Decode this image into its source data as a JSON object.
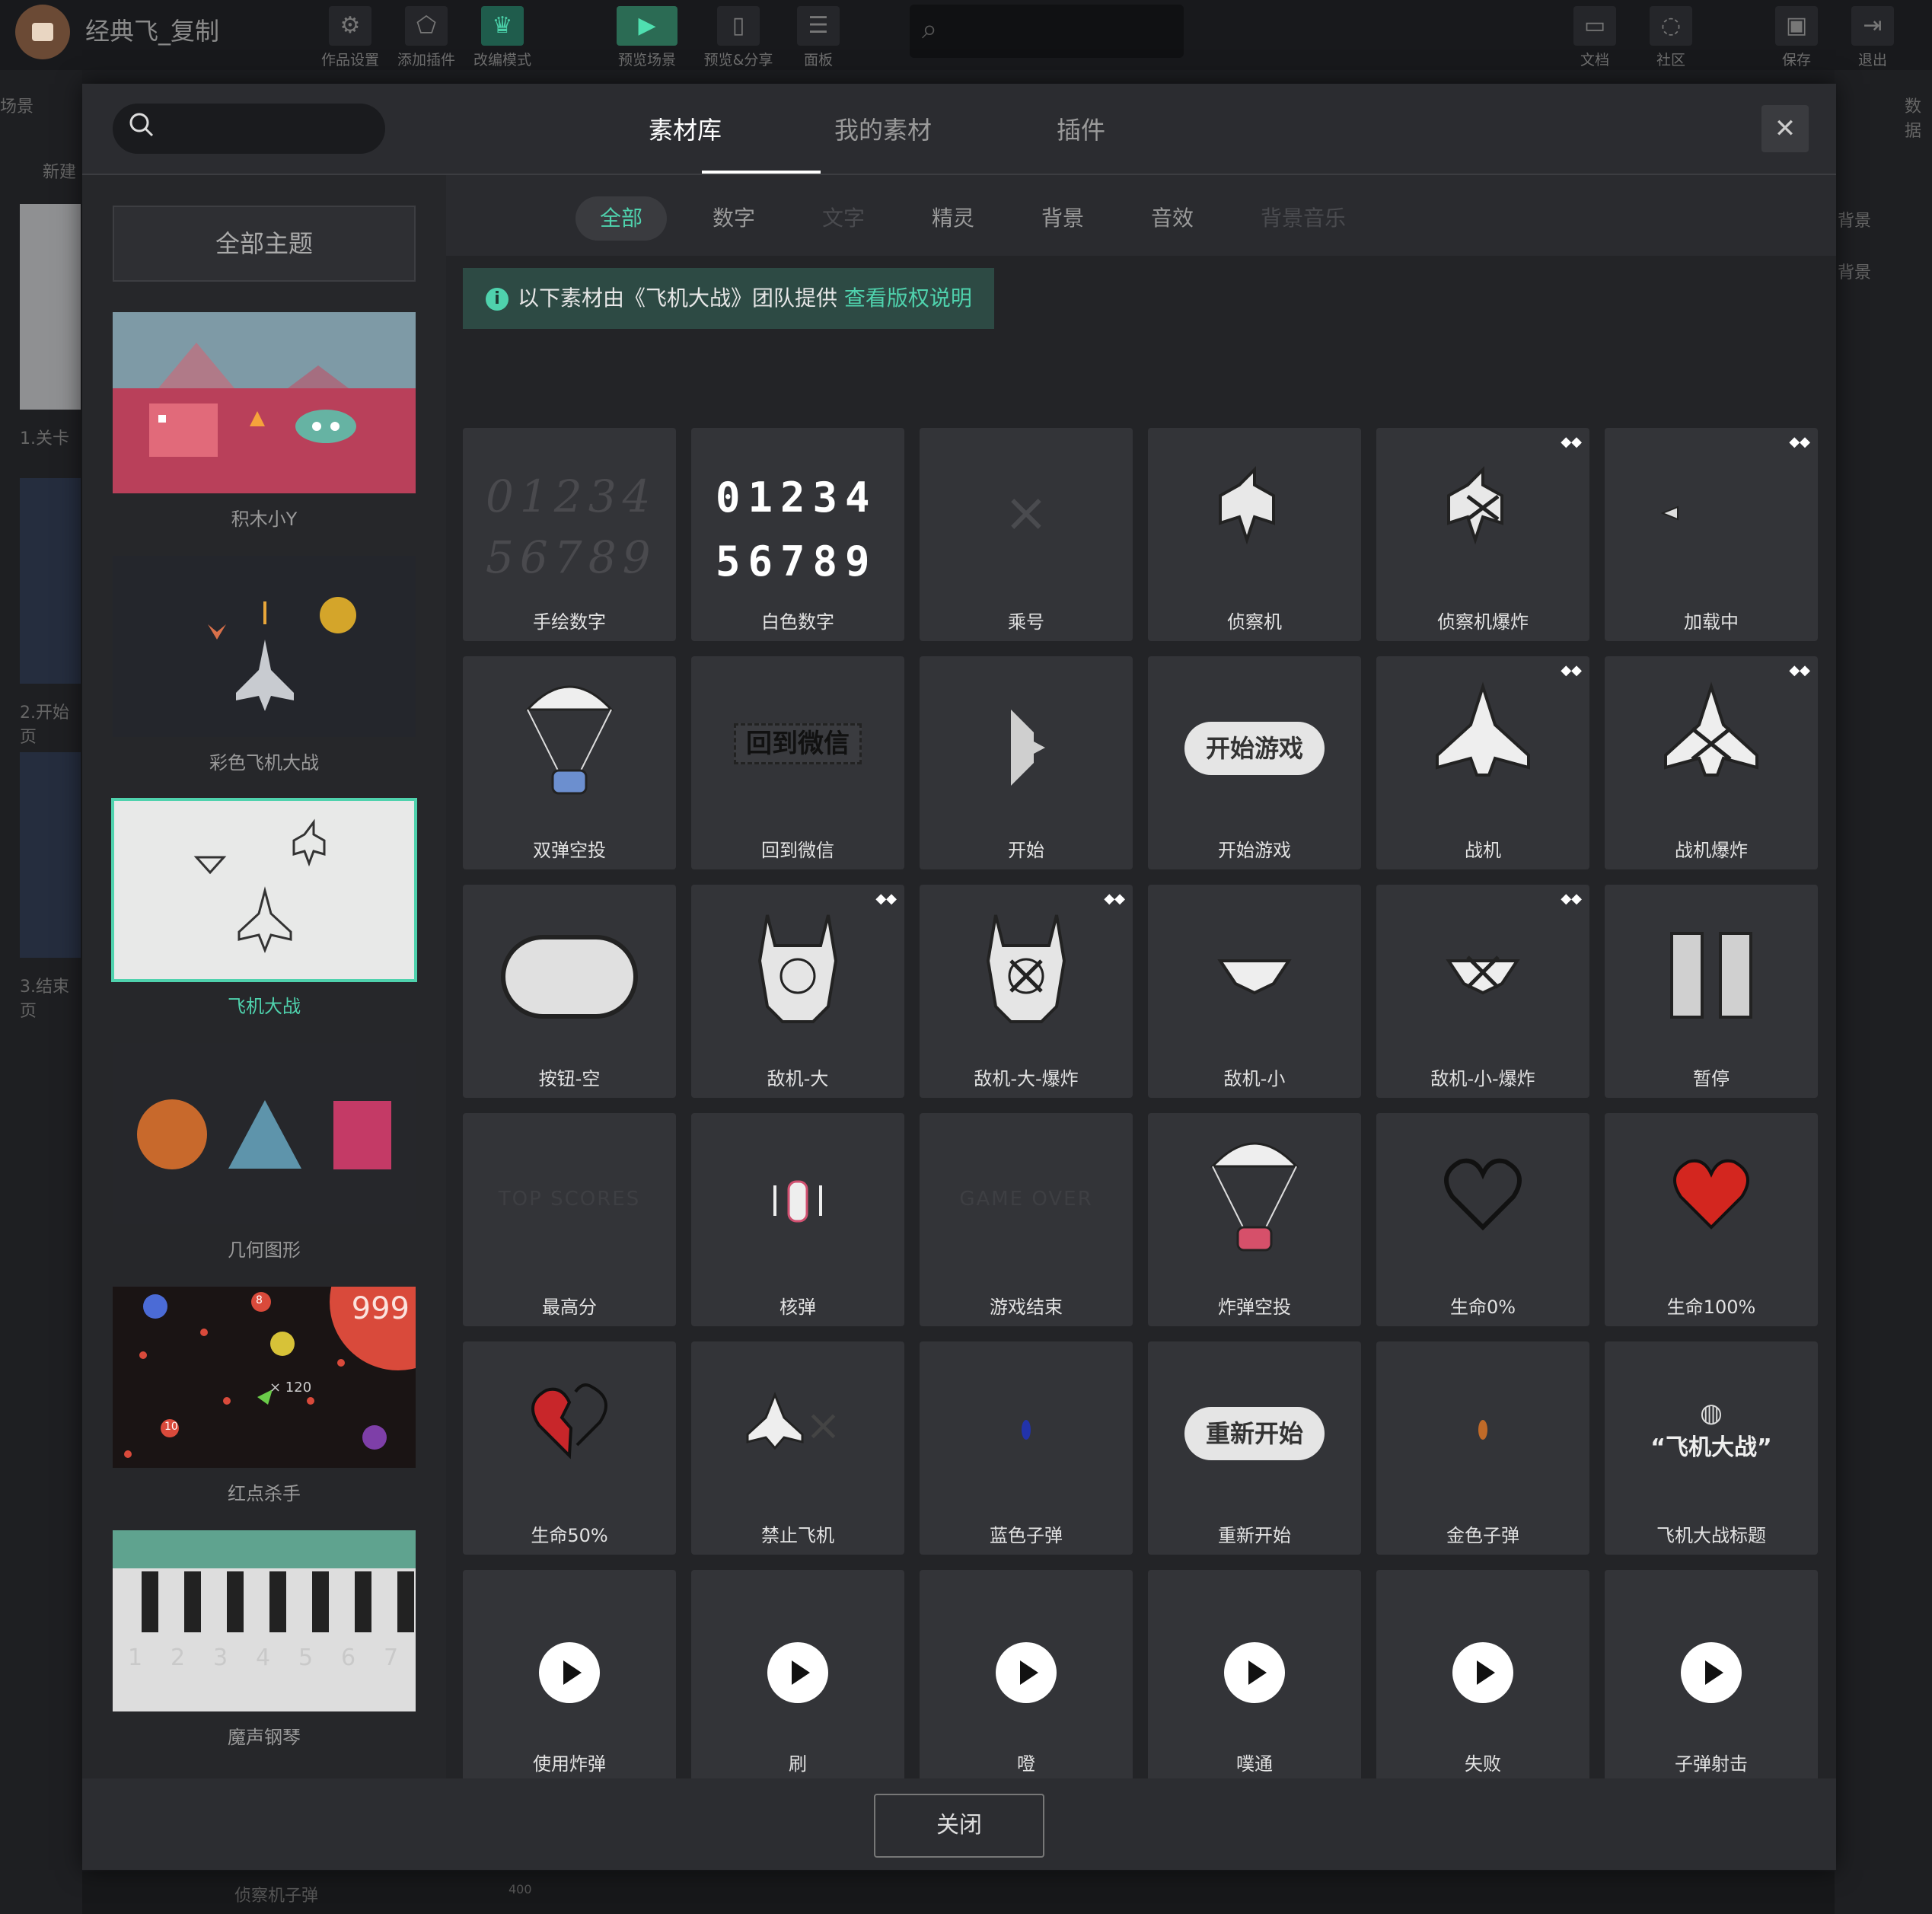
{
  "app": {
    "title": "经典飞_复制"
  },
  "toolbar": [
    {
      "label": "作品设置",
      "icon": "⚙"
    },
    {
      "label": "添加插件",
      "icon": "⬠"
    },
    {
      "label": "改编模式",
      "icon": "♛"
    },
    {
      "label": "预览场景",
      "icon": "▶"
    },
    {
      "label": "预览&分享",
      "icon": "▯"
    },
    {
      "label": "面板",
      "icon": "☰"
    },
    {
      "label": "文档",
      "icon": "▭"
    },
    {
      "label": "社区",
      "icon": "◌"
    },
    {
      "label": "保存",
      "icon": "▣"
    },
    {
      "label": "退出",
      "icon": "⇥"
    }
  ],
  "left_panel": {
    "header": "场景",
    "new": "新建",
    "scenes": [
      "1.关卡",
      "2.开始页",
      "3.结束页"
    ]
  },
  "right_panel": {
    "header": "数据",
    "items": [
      "背景",
      "背景"
    ]
  },
  "bottom": {
    "item": "侦察机子弹",
    "num": "400"
  },
  "modal": {
    "tabs": [
      {
        "label": "素材库",
        "active": true
      },
      {
        "label": "我的素材",
        "active": false
      },
      {
        "label": "插件",
        "active": false
      }
    ],
    "close_icon": "✕",
    "all_themes": "全部主题",
    "themes": [
      {
        "label": "积木小Y",
        "selected": false
      },
      {
        "label": "彩色飞机大战",
        "selected": false
      },
      {
        "label": "飞机大战",
        "selected": true
      },
      {
        "label": "几何图形",
        "selected": false
      },
      {
        "label": "红点杀手",
        "selected": false,
        "counter": "999",
        "multiplier": "× 120",
        "dot1": "8",
        "dot2": "10"
      },
      {
        "label": "魔声钢琴",
        "selected": false,
        "keys": [
          "1",
          "2",
          "3",
          "4",
          "5",
          "6",
          "7"
        ]
      }
    ],
    "subtabs": [
      {
        "label": "全部",
        "state": "active"
      },
      {
        "label": "数字",
        "state": "normal"
      },
      {
        "label": "文字",
        "state": "dim"
      },
      {
        "label": "精灵",
        "state": "normal"
      },
      {
        "label": "背景",
        "state": "normal"
      },
      {
        "label": "音效",
        "state": "normal"
      },
      {
        "label": "背景音乐",
        "state": "dim"
      }
    ],
    "notice": {
      "text": "以下素材由《飞机大战》团队提供",
      "link": "查看版权说明"
    },
    "assets": [
      {
        "label": "手绘数字",
        "art": "hand-digits",
        "digits1": "01234",
        "digits2": "56789"
      },
      {
        "label": "白色数字",
        "art": "white-digits",
        "digits1": "01234",
        "digits2": "56789"
      },
      {
        "label": "乘号",
        "art": "times",
        "glyph": "×"
      },
      {
        "label": "侦察机",
        "art": "scout"
      },
      {
        "label": "侦察机爆炸",
        "art": "scout-boom",
        "badge": true
      },
      {
        "label": "加载中",
        "art": "loading",
        "badge": true
      },
      {
        "label": "双弹空投",
        "art": "parachute-blue"
      },
      {
        "label": "回到微信",
        "art": "text-btn",
        "text": "回到微信"
      },
      {
        "label": "开始",
        "art": "start-shape"
      },
      {
        "label": "开始游戏",
        "art": "pill",
        "text": "开始游戏"
      },
      {
        "label": "战机",
        "art": "fighter",
        "badge": true
      },
      {
        "label": "战机爆炸",
        "art": "fighter-boom",
        "badge": true
      },
      {
        "label": "按钮-空",
        "art": "empty-btn"
      },
      {
        "label": "敌机-大",
        "art": "big-enemy",
        "badge": true
      },
      {
        "label": "敌机-大-爆炸",
        "art": "big-enemy-boom",
        "badge": true
      },
      {
        "label": "敌机-小",
        "art": "small-enemy"
      },
      {
        "label": "敌机-小-爆炸",
        "art": "small-enemy-boom",
        "badge": true
      },
      {
        "label": "暂停",
        "art": "pause"
      },
      {
        "label": "最高分",
        "art": "faint-text",
        "text": "TOP SCORES"
      },
      {
        "label": "核弹",
        "art": "nuke"
      },
      {
        "label": "游戏结束",
        "art": "faint-text",
        "text": "GAME OVER"
      },
      {
        "label": "炸弹空投",
        "art": "parachute-red"
      },
      {
        "label": "生命0%",
        "art": "heart-empty"
      },
      {
        "label": "生命100%",
        "art": "heart-full"
      },
      {
        "label": "生命50%",
        "art": "heart-half"
      },
      {
        "label": "禁止飞机",
        "art": "no-plane",
        "glyph": "×"
      },
      {
        "label": "蓝色子弹",
        "art": "bullet-blue"
      },
      {
        "label": "重新开始",
        "art": "pill",
        "text": "重新开始"
      },
      {
        "label": "金色子弹",
        "art": "bullet-gold"
      },
      {
        "label": "飞机大战标题",
        "art": "title",
        "text": "“飞机大战”"
      },
      {
        "label": "使用炸弹",
        "art": "sound"
      },
      {
        "label": "刷",
        "art": "sound"
      },
      {
        "label": "噔",
        "art": "sound"
      },
      {
        "label": "噗通",
        "art": "sound"
      },
      {
        "label": "失败",
        "art": "sound"
      },
      {
        "label": "子弹射击",
        "art": "sound"
      }
    ],
    "close_button": "关闭"
  },
  "colors": {
    "accent": "#4fd2ad",
    "notice_bg": "#2d4a44"
  }
}
